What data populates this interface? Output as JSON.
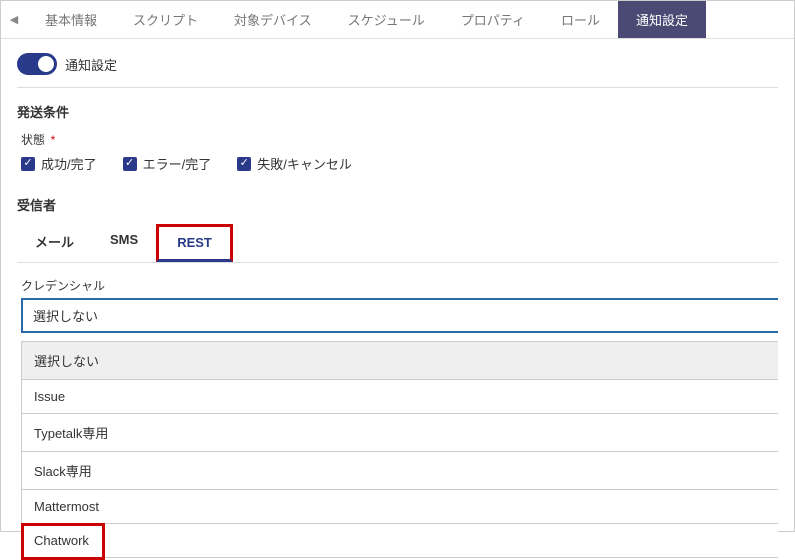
{
  "tabs": {
    "items": [
      "基本情報",
      "スクリプト",
      "対象デバイス",
      "スケジュール",
      "プロパティ",
      "ロール",
      "通知設定"
    ],
    "active": "通知設定"
  },
  "toggle": {
    "label": "通知設定",
    "on": true
  },
  "conditions": {
    "title": "発送条件",
    "state_label": "状態",
    "checkboxes": [
      "成功/完了",
      "エラー/完了",
      "失敗/キャンセル"
    ]
  },
  "recipients": {
    "title": "受信者",
    "sub_tabs": [
      "メール",
      "SMS",
      "REST"
    ],
    "active": "REST"
  },
  "credential": {
    "label": "クレデンシャル",
    "selected": "選択しない",
    "options": [
      "選択しない",
      "Issue",
      "Typetalk専用",
      "Slack専用",
      "Mattermost",
      "Chatwork"
    ]
  }
}
